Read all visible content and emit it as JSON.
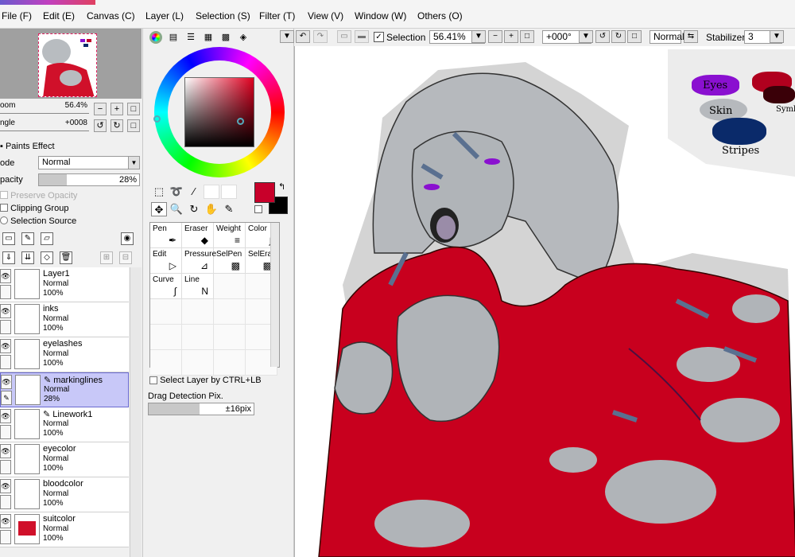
{
  "menu": [
    "File (F)",
    "Edit (E)",
    "Canvas (C)",
    "Layer (L)",
    "Selection (S)",
    "Filter (T)",
    "View (V)",
    "Window (W)",
    "Others (O)"
  ],
  "navigator": {
    "zoom_label": "oom",
    "zoom_value": "56.4%",
    "angle_label": "ngle",
    "angle_value": "+0008"
  },
  "layer_panel": {
    "paints_effect": "Paints Effect",
    "mode_label": "ode",
    "mode_value": "Normal",
    "opacity_label": "pacity",
    "opacity_value": "28%",
    "opacity_fraction": 0.28,
    "preserve_opacity": "Preserve Opacity",
    "clipping_group": "Clipping Group",
    "selection_source": "Selection Source"
  },
  "layers": [
    {
      "name": "Layer1",
      "mode": "Normal",
      "opacity": "100%"
    },
    {
      "name": "inks",
      "mode": "Normal",
      "opacity": "100%"
    },
    {
      "name": "eyelashes",
      "mode": "Normal",
      "opacity": "100%"
    },
    {
      "name": "markinglines",
      "mode": "Normal",
      "opacity": "28%"
    },
    {
      "name": "Linework1",
      "mode": "Normal",
      "opacity": "100%"
    },
    {
      "name": "eyecolor",
      "mode": "Normal",
      "opacity": "100%"
    },
    {
      "name": "bloodcolor",
      "mode": "Normal",
      "opacity": "100%"
    },
    {
      "name": "suitcolor",
      "mode": "Normal",
      "opacity": "100%"
    }
  ],
  "brushes": [
    {
      "name": "Pen",
      "icon": "✒"
    },
    {
      "name": "Eraser",
      "icon": "◆"
    },
    {
      "name": "Weight",
      "icon": "≡"
    },
    {
      "name": "Color",
      "icon": "∫"
    },
    {
      "name": "Edit",
      "icon": "▷"
    },
    {
      "name": "Pressure",
      "icon": "⊿"
    },
    {
      "name": "SelPen",
      "icon": "▩"
    },
    {
      "name": "SelEras",
      "icon": "▩"
    },
    {
      "name": "Curve",
      "icon": "∫"
    },
    {
      "name": "Line",
      "icon": "N"
    }
  ],
  "tool_options": {
    "select_layer_ctrl": "Select Layer by CTRL+LB",
    "drag_detection": "Drag Detection Pix.",
    "drag_value": "±16pix"
  },
  "toolbar": {
    "selection_label": "Selection",
    "zoom": "56.41%",
    "rotation": "+000°",
    "blend_mode": "Normal",
    "stabilizer_label": "Stabilizer",
    "stabilizer_value": "3"
  },
  "canvas_legend": {
    "eyes": "Eyes",
    "skin": "Skin",
    "stripes": "Stripes",
    "symbi": "Symbi"
  },
  "colors": {
    "primary": "#c8002a",
    "secondary": "#000000",
    "eyes": "#8a10d0",
    "stripes": "#0a2a6a",
    "skin": "#b0b4b8"
  }
}
